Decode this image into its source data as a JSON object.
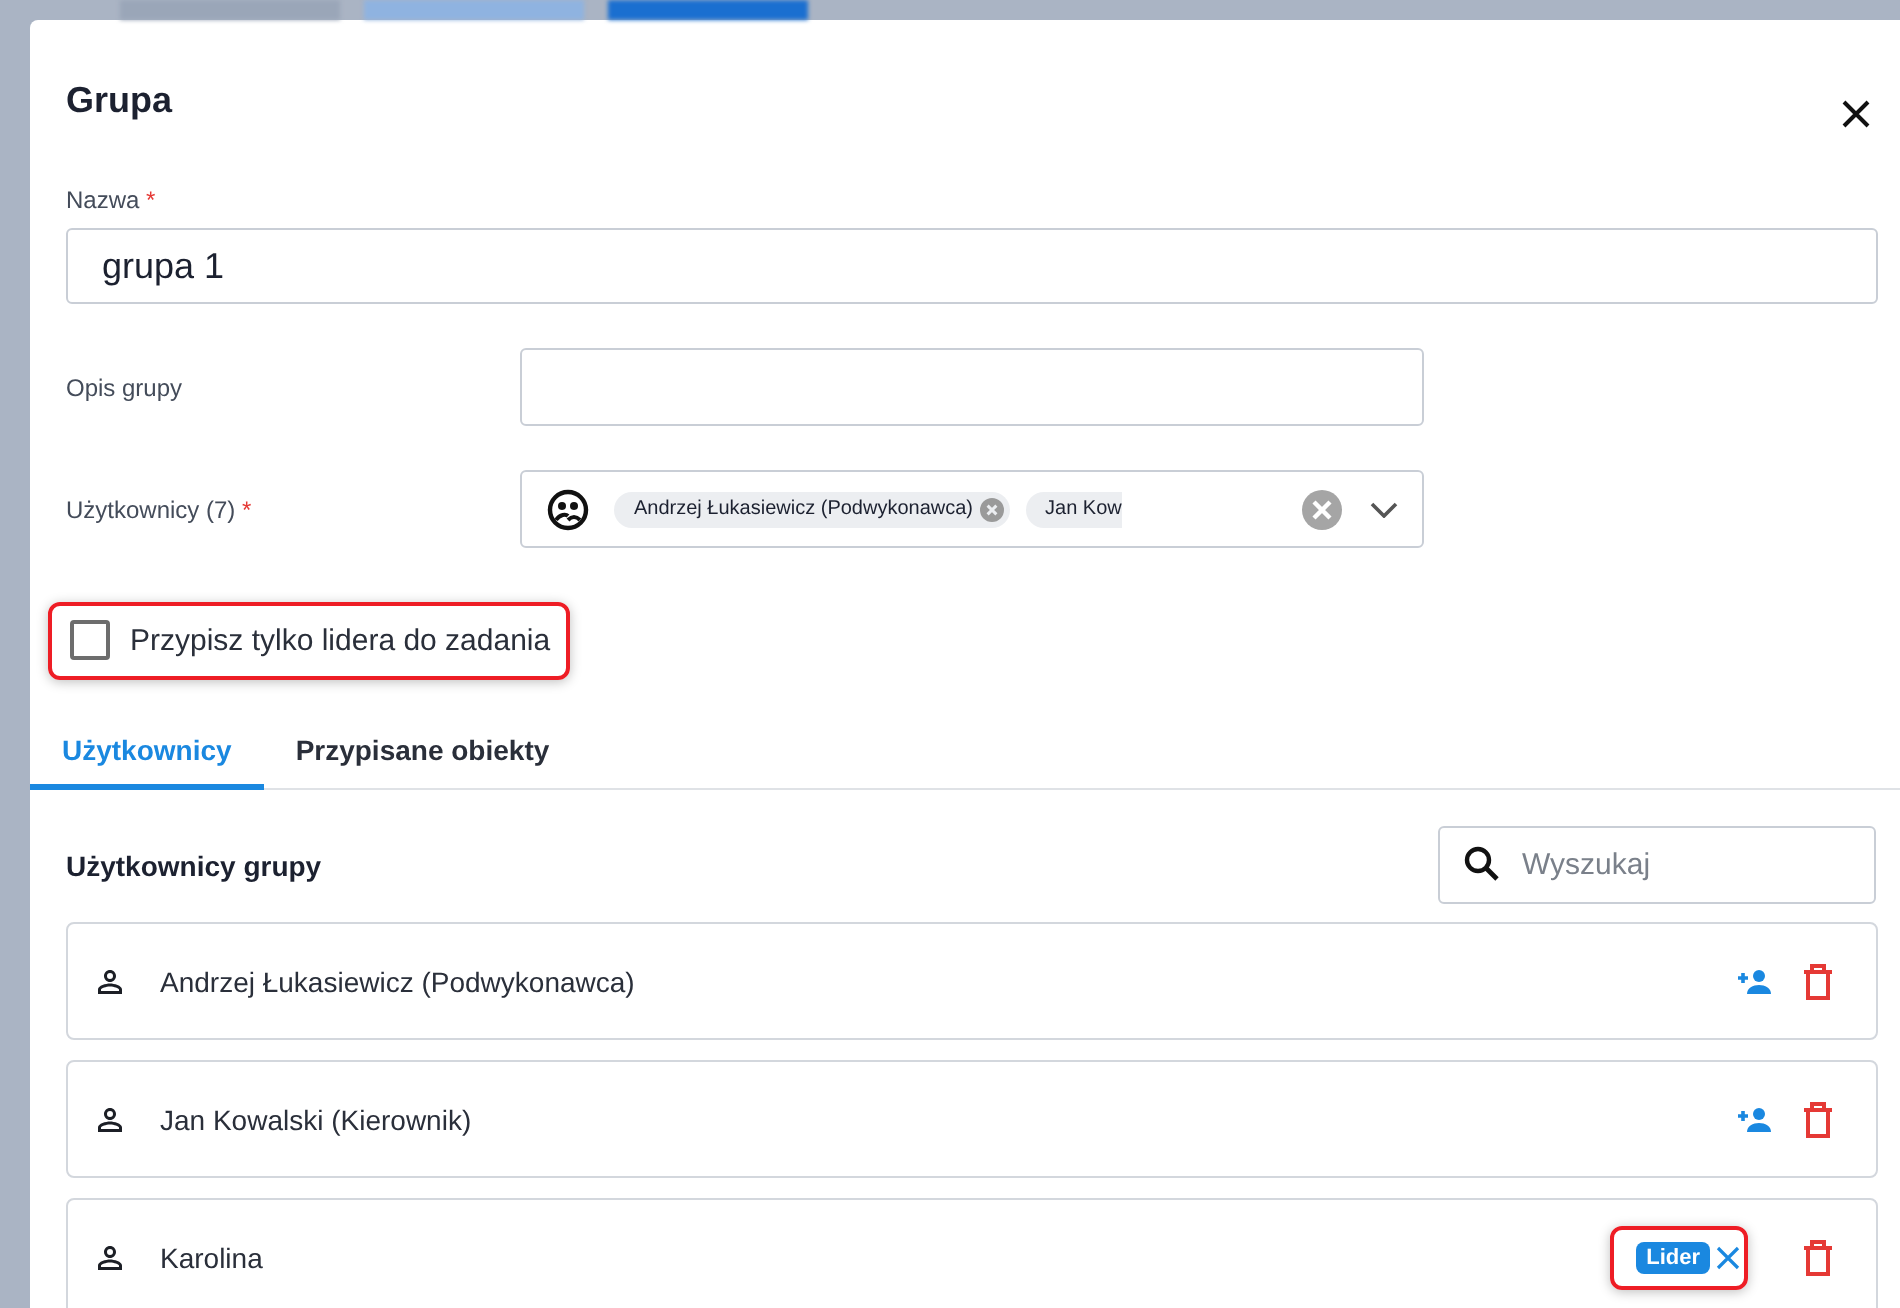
{
  "dialog": {
    "title": "Grupa"
  },
  "name_field": {
    "label": "Nazwa",
    "required_mark": "*",
    "value": "grupa 1"
  },
  "description_field": {
    "label": "Opis grupy"
  },
  "users_field": {
    "label": "Użytkownicy (7)",
    "required_mark": "*",
    "chips": [
      {
        "label": "Andrzej Łukasiewicz (Podwykonawca)",
        "removable": true
      },
      {
        "label": "Jan Kow",
        "removable": false
      }
    ]
  },
  "leader_only": {
    "label": "Przypisz tylko lidera do zadania",
    "checked": false,
    "highlighted": true
  },
  "tabs": [
    {
      "label": "Użytkownicy",
      "selected": true
    },
    {
      "label": "Przypisane obiekty",
      "selected": false
    }
  ],
  "members": {
    "title": "Użytkownicy grupy",
    "search": {
      "placeholder": "Wyszukaj"
    },
    "rows": [
      {
        "name": "Andrzej Łukasiewicz (Podwykonawca)",
        "kind": "member"
      },
      {
        "name": "Jan Kowalski (Kierownik)",
        "kind": "member"
      },
      {
        "name": "Karolina",
        "kind": "leader",
        "badge": "Lider",
        "highlighted": true
      }
    ]
  }
}
